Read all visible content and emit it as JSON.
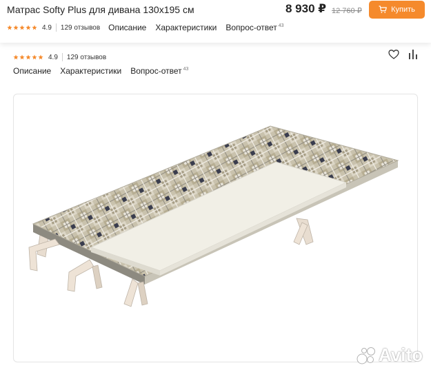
{
  "header": {
    "title": "Матрас Softy Plus для дивана 130x195 см",
    "price": "8 930 ₽",
    "old_price": "12 760 ₽",
    "buy_label": "Купить"
  },
  "rating": {
    "value": "4.9",
    "stars": 5,
    "reviews": "129 отзывов"
  },
  "nav": {
    "description": "Описание",
    "characteristics": "Характеристики",
    "qa": "Вопрос-ответ",
    "qa_count": "43"
  },
  "watermark": {
    "text": "Avito"
  },
  "colors": {
    "accent": "#f58a2c",
    "star": "#f58a2c",
    "text": "#222222"
  },
  "icons": [
    "cart-icon",
    "star-icon",
    "heart-icon",
    "stats-icon"
  ]
}
